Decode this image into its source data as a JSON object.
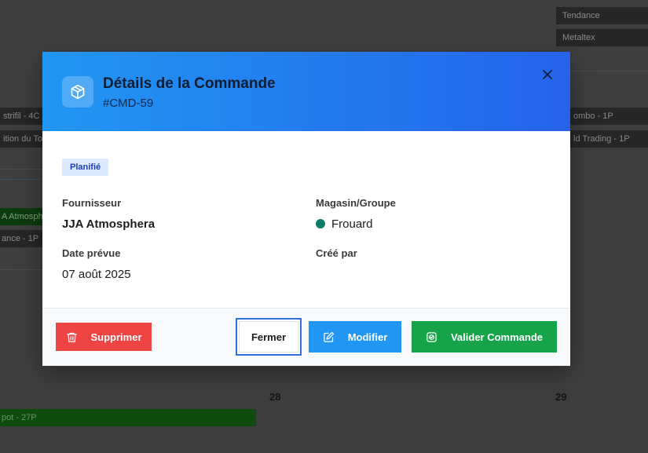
{
  "background": {
    "chips": [
      {
        "text": "Tendance"
      },
      {
        "text": "Metaltex"
      },
      {
        "text": "strifil - 4C"
      },
      {
        "text": "ition du To"
      },
      {
        "text": "ombo - 1P"
      },
      {
        "text": "ld Trading - 1P"
      },
      {
        "text": "A Atmosph"
      },
      {
        "text": "ance - 1P"
      },
      {
        "text": "pot - 27P"
      }
    ],
    "day_numbers": [
      "28",
      "29"
    ]
  },
  "modal": {
    "title": "Détails de la Commande",
    "order_id": "#CMD-59",
    "header_icon": "package-icon",
    "close_icon": "close-icon",
    "colors": {
      "header_start": "#2196f3",
      "header_end": "#2563eb",
      "delete": "#ef4444",
      "edit": "#2196f3",
      "validate": "#16a34a",
      "store_dot": "#0f7b67"
    },
    "status": "Planifié",
    "fields": {
      "supplier_label": "Fournisseur",
      "supplier_value": "JJA Atmosphera",
      "store_label": "Magasin/Groupe",
      "store_value": "Frouard",
      "date_label": "Date prévue",
      "date_value": "07 août 2025",
      "created_by_label": "Créé par"
    },
    "buttons": {
      "delete": "Supprimer",
      "close": "Fermer",
      "edit": "Modifier",
      "validate": "Valider Commande"
    }
  }
}
